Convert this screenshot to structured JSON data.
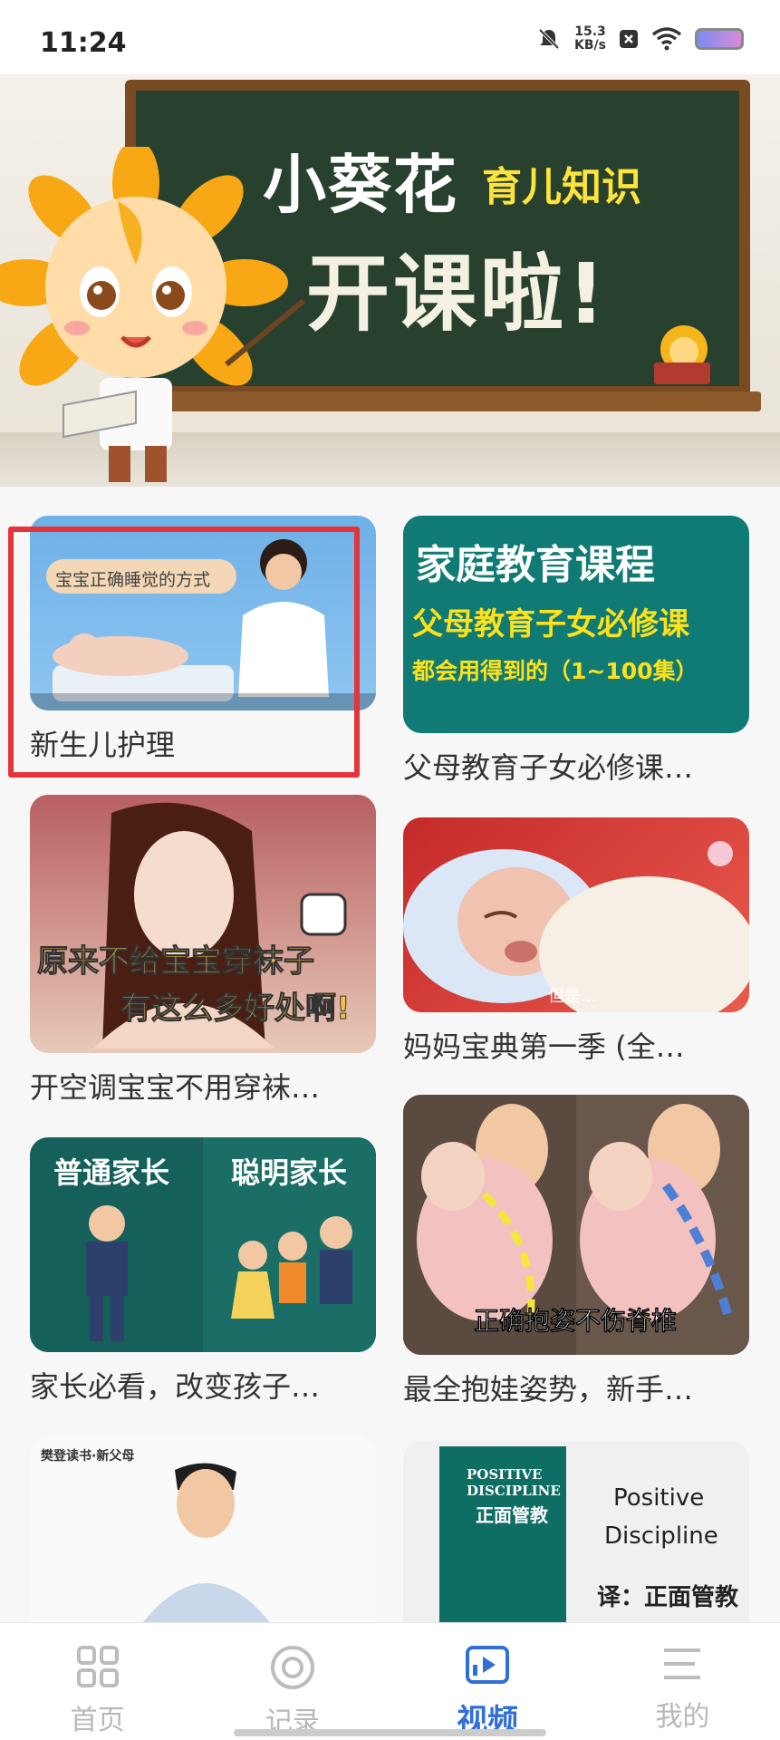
{
  "status_bar": {
    "time": "11:24",
    "network_speed_value": "15.3",
    "network_speed_unit": "KB/s",
    "icons": [
      "mute-bell-icon",
      "close-box-icon",
      "wifi-icon",
      "battery-icon"
    ]
  },
  "banner": {
    "brand": "小葵花",
    "subtitle": "育儿知识",
    "headline": "开课啦!"
  },
  "videos": [
    {
      "title": "新生儿护理",
      "thumb_caption": "宝宝正确睡觉的方式",
      "selected": true
    },
    {
      "title": "父母教育子女必修课…",
      "thumb_lines": [
        "家庭教育课程",
        "父母教育子女必修课",
        "都会用得到的（1~100集）"
      ]
    },
    {
      "title": "开空调宝宝不用穿袜…",
      "thumb_lines": [
        "原来不给宝宝穿袜子",
        "有这么多好处啊!"
      ]
    },
    {
      "title": "妈妈宝典第一季 (全…",
      "thumb_caption": "但是..."
    },
    {
      "title": "家长必看，改变孩子…",
      "thumb_lines": [
        "普通家长",
        "聪明家长"
      ]
    },
    {
      "title": "最全抱娃姿势，新手…",
      "thumb_caption": "正确抱姿不伤脊椎"
    },
    {
      "title": "",
      "thumb_caption": "樊登读书·新父母"
    },
    {
      "title": "",
      "thumb_lines": [
        "POSITIVE",
        "DISCIPLINE",
        "正面管教",
        "Positive",
        "Discipline",
        "译：正面管教"
      ]
    }
  ],
  "tabs": [
    {
      "label": "首页",
      "icon": "grid-icon",
      "active": false
    },
    {
      "label": "记录",
      "icon": "record-icon",
      "active": false
    },
    {
      "label": "视频",
      "icon": "video-icon",
      "active": true
    },
    {
      "label": "我的",
      "icon": "menu-icon",
      "active": false
    }
  ],
  "colors": {
    "accent": "#2f6fd6",
    "highlight": "#e3343a",
    "chalkboard": "#28412f",
    "teal_card": "#0f7b74"
  }
}
